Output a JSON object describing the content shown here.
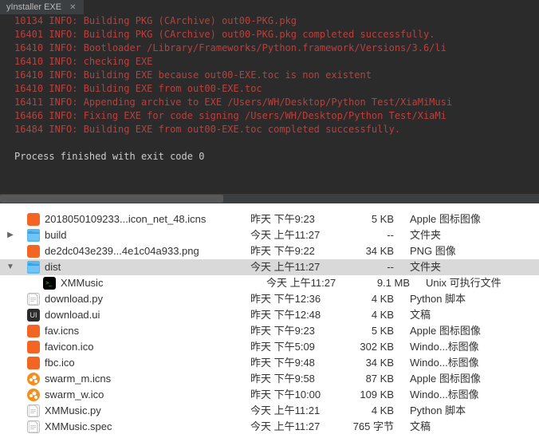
{
  "terminal": {
    "tab_title": "yInstaller EXE",
    "process_finished": "Process finished with exit code 0",
    "log": [
      "10134 INFO: Building PKG (CArchive) out00-PKG.pkg",
      "16401 INFO: Building PKG (CArchive) out00-PKG.pkg completed successfully.",
      "16410 INFO: Bootloader /Library/Frameworks/Python.framework/Versions/3.6/li",
      "16410 INFO: checking EXE",
      "16410 INFO: Building EXE because out00-EXE.toc is non existent",
      "16410 INFO: Building EXE from out00-EXE.toc",
      "16411 INFO: Appending archive to EXE /Users/WH/Desktop/Python Test/XiaMiMusi",
      "16466 INFO: Fixing EXE for code signing /Users/WH/Desktop/Python Test/XiaMi",
      "16484 INFO: Building EXE from out00-EXE.toc completed successfully."
    ]
  },
  "files": [
    {
      "name": "2018050109233...icon_net_48.icns",
      "modified": "昨天 下午9:23",
      "size": "5 KB",
      "kind": "Apple 图标图像",
      "depth": 1,
      "icon": "orange",
      "disclosure": ""
    },
    {
      "name": "build",
      "modified": "今天 上午11:27",
      "size": "--",
      "kind": "文件夹",
      "depth": 1,
      "icon": "folder",
      "disclosure": "▶"
    },
    {
      "name": "de2dc043e239...4e1c04a933.png",
      "modified": "昨天 下午9:22",
      "size": "34 KB",
      "kind": "PNG 图像",
      "depth": 1,
      "icon": "orange",
      "disclosure": ""
    },
    {
      "name": "dist",
      "modified": "今天 上午11:27",
      "size": "--",
      "kind": "文件夹",
      "depth": 1,
      "icon": "folder",
      "disclosure": "▼",
      "selected": true
    },
    {
      "name": "XMMusic",
      "modified": "今天 上午11:27",
      "size": "9.1 MB",
      "kind": "Unix 可执行文件",
      "depth": 2,
      "icon": "terminal",
      "disclosure": ""
    },
    {
      "name": "download.py",
      "modified": "昨天 下午12:36",
      "size": "4 KB",
      "kind": "Python 脚本",
      "depth": 1,
      "icon": "doc",
      "disclosure": ""
    },
    {
      "name": "download.ui",
      "modified": "昨天 下午12:48",
      "size": "4 KB",
      "kind": "文稿",
      "depth": 1,
      "icon": "uidoc",
      "disclosure": ""
    },
    {
      "name": "fav.icns",
      "modified": "昨天 下午9:23",
      "size": "5 KB",
      "kind": "Apple 图标图像",
      "depth": 1,
      "icon": "orange",
      "disclosure": ""
    },
    {
      "name": "favicon.ico",
      "modified": "昨天 下午5:09",
      "size": "302 KB",
      "kind": "Windo...标图像",
      "depth": 1,
      "icon": "orange",
      "disclosure": ""
    },
    {
      "name": "fbc.ico",
      "modified": "昨天 下午9:48",
      "size": "34 KB",
      "kind": "Windo...标图像",
      "depth": 1,
      "icon": "orange",
      "disclosure": ""
    },
    {
      "name": "swarm_m.icns",
      "modified": "昨天 下午9:58",
      "size": "87 KB",
      "kind": "Apple 图标图像",
      "depth": 1,
      "icon": "swarm",
      "disclosure": ""
    },
    {
      "name": "swarm_w.ico",
      "modified": "昨天 下午10:00",
      "size": "109 KB",
      "kind": "Windo...标图像",
      "depth": 1,
      "icon": "swarm",
      "disclosure": ""
    },
    {
      "name": "XMMusic.py",
      "modified": "今天 上午11:21",
      "size": "4 KB",
      "kind": "Python 脚本",
      "depth": 1,
      "icon": "doc",
      "disclosure": ""
    },
    {
      "name": "XMMusic.spec",
      "modified": "今天 上午11:27",
      "size": "765 字节",
      "kind": "文稿",
      "depth": 1,
      "icon": "doc",
      "disclosure": ""
    }
  ]
}
